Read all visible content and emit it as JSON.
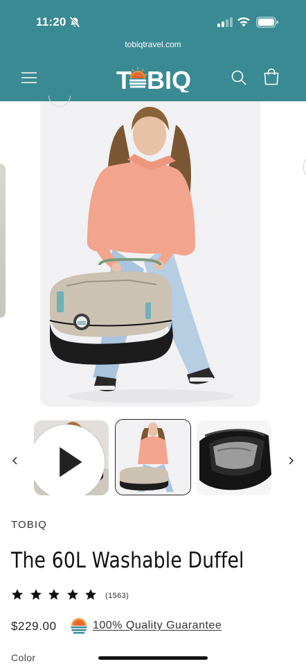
{
  "status_bar": {
    "time": "11:20",
    "icons": [
      "bell-slash-icon",
      "cellular-signal-icon",
      "wifi-icon",
      "battery-icon"
    ]
  },
  "browser": {
    "url": "tobiqtravel.com"
  },
  "header": {
    "logo_text": "TOBIQ",
    "icons": [
      "hamburger-menu-icon",
      "search-icon",
      "shopping-bag-icon"
    ],
    "brand_color": "#3a8a94"
  },
  "gallery": {
    "thumbnails": [
      {
        "label": "video",
        "icon": "play-icon"
      },
      {
        "label": "selected"
      },
      {
        "label": "interior"
      }
    ],
    "icons": [
      "chevron-left-icon",
      "chevron-right-icon"
    ]
  },
  "product": {
    "vendor": "TOBIQ",
    "title": "The 60L Washable Duffel",
    "rating": 5,
    "review_count": "(1563)",
    "price": "$229.00",
    "guarantee_link": "100% Quality Guarantee",
    "option_label": "Color"
  }
}
